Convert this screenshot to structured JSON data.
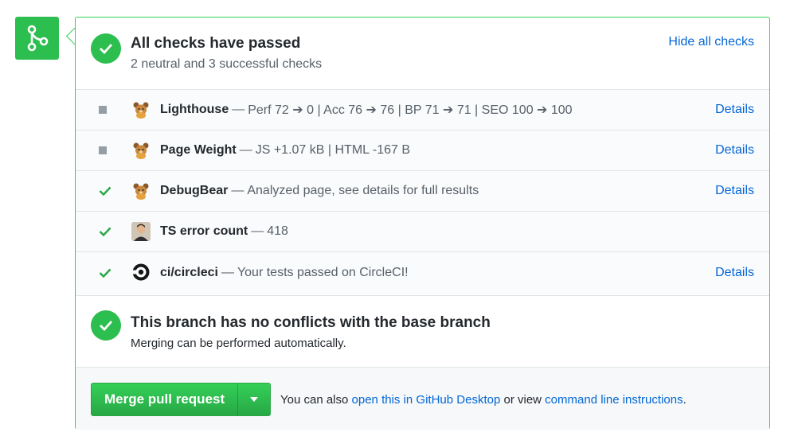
{
  "status": {
    "title": "All checks have passed",
    "subtitle": "2 neutral and 3 successful checks",
    "hide_link": "Hide all checks"
  },
  "checks": [
    {
      "state": "neutral",
      "avatar": "bear-avatar",
      "name": "Lighthouse",
      "separator": "—",
      "description": "Perf 72 ➔ 0 | Acc 76 ➔ 76 | BP 71 ➔ 71 | SEO 100 ➔ 100",
      "details": "Details"
    },
    {
      "state": "neutral",
      "avatar": "bear-avatar",
      "name": "Page Weight",
      "separator": "—",
      "description": "JS +1.07 kB | HTML -167 B",
      "details": "Details"
    },
    {
      "state": "success",
      "avatar": "bear-avatar",
      "name": "DebugBear",
      "separator": "—",
      "description": "Analyzed page, see details for full results",
      "details": "Details"
    },
    {
      "state": "success",
      "avatar": "person-avatar",
      "name": "TS error count",
      "separator": "—",
      "description": "418",
      "details": ""
    },
    {
      "state": "success",
      "avatar": "circleci-logo",
      "name": "ci/circleci",
      "separator": "—",
      "description": "Your tests passed on CircleCI!",
      "details": "Details"
    }
  ],
  "merge": {
    "title": "This branch has no conflicts with the base branch",
    "subtitle": "Merging can be performed automatically.",
    "button_label": "Merge pull request",
    "hint_prefix": "You can also",
    "desktop_link": "open this in GitHub Desktop",
    "hint_middle": "or view",
    "cli_link": "command line instructions",
    "hint_suffix": "."
  },
  "colors": {
    "success": "#2cbe4e",
    "link": "#0366d6",
    "border_green": "#34d058",
    "neutral": "#959da5"
  }
}
